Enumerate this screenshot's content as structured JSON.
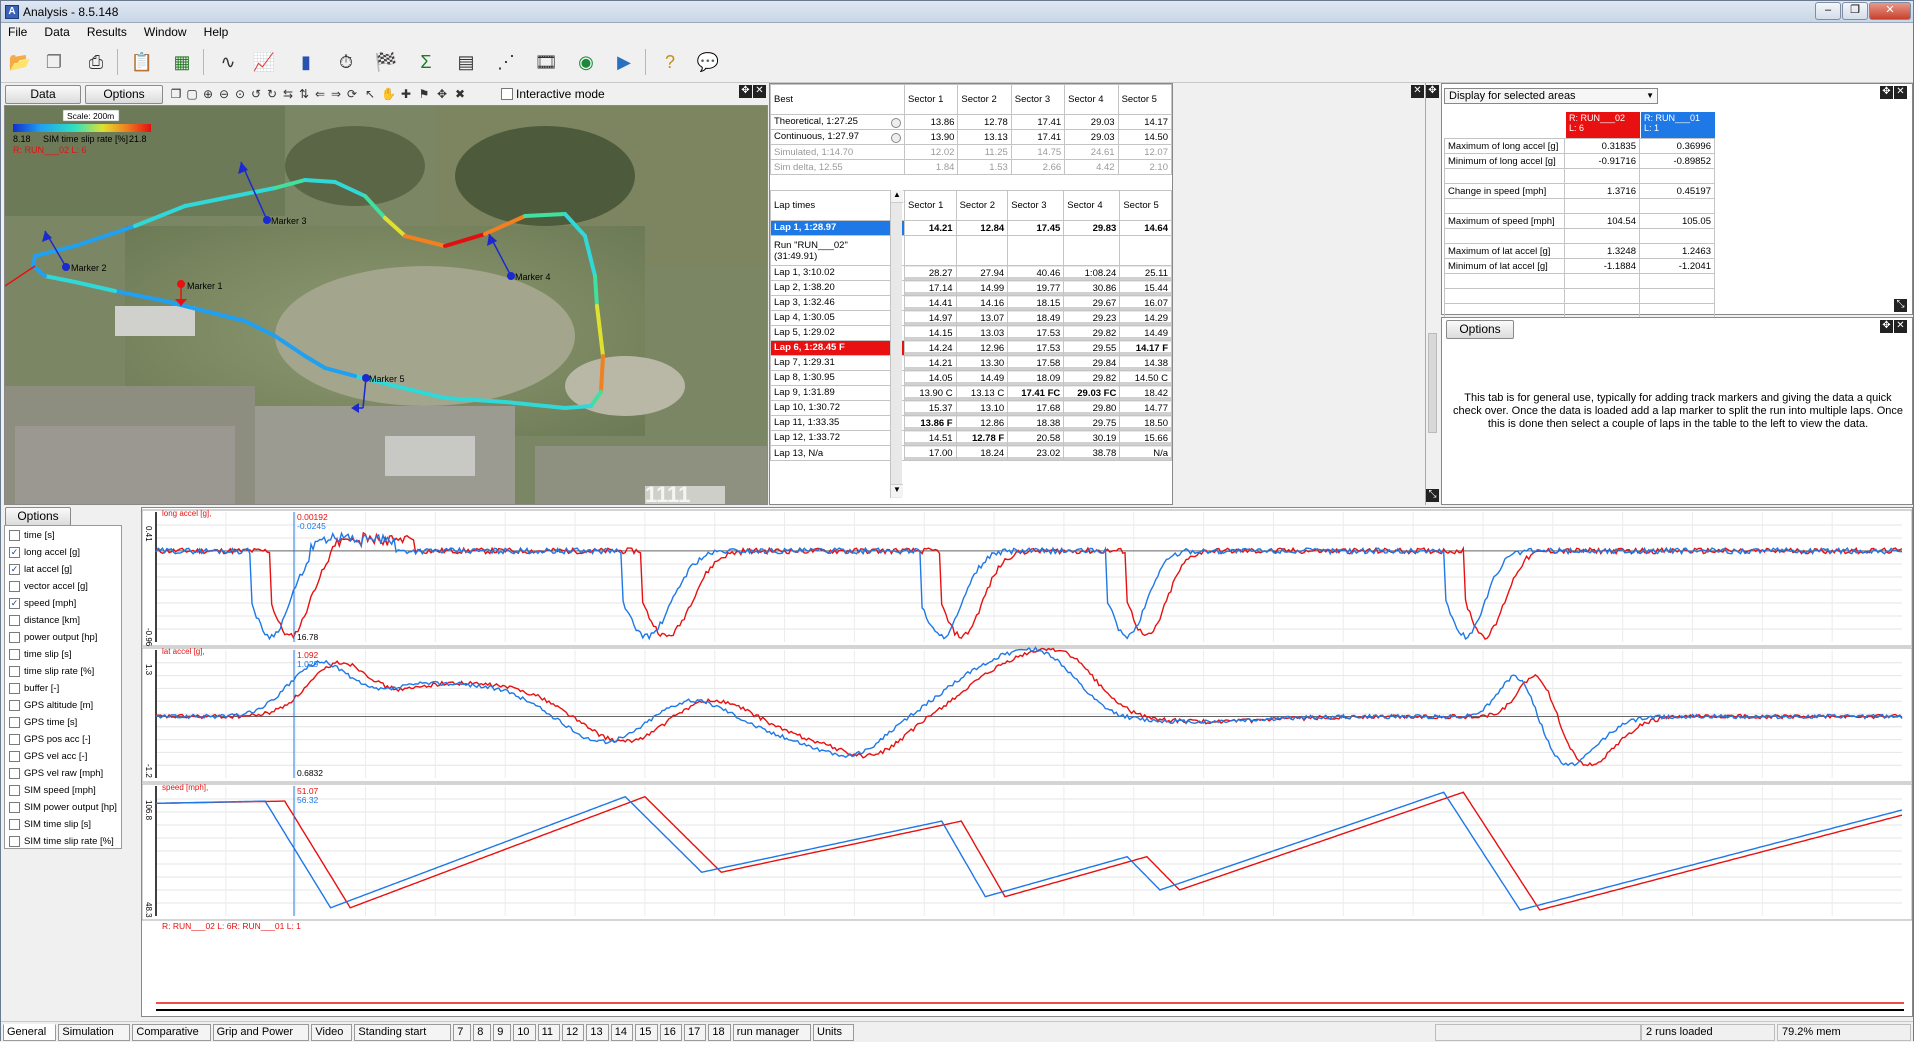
{
  "window": {
    "title": "Analysis - 8.5.148"
  },
  "menu": [
    "File",
    "Data",
    "Results",
    "Window",
    "Help"
  ],
  "map": {
    "data_tab": "Data",
    "options_tab": "Options",
    "interactive_mode": "Interactive mode",
    "scale": "Scale: 200m",
    "legend_min": "8.18",
    "legend_label": "SIM time slip rate [%]",
    "legend_max": "21.8",
    "run_label": "R: RUN___02  L: 6",
    "markers": [
      "Marker 1",
      "Marker 2",
      "Marker 3",
      "Marker 4",
      "Marker 5"
    ],
    "watermark": "1111"
  },
  "best_table": {
    "header": [
      "Best",
      "Sector 1",
      "Sector 2",
      "Sector 3",
      "Sector 4",
      "Sector 5"
    ],
    "rows": [
      {
        "label": "Theoretical, 1:27.25",
        "v": [
          "13.86",
          "12.78",
          "17.41",
          "29.03",
          "14.17"
        ]
      },
      {
        "label": "Continuous, 1:27.97",
        "v": [
          "13.90",
          "13.13",
          "17.41",
          "29.03",
          "14.50"
        ]
      },
      {
        "label": "Simulated, 1:14.70",
        "v": [
          "12.02",
          "11.25",
          "14.75",
          "24.61",
          "12.07"
        ]
      },
      {
        "label": "Sim delta, 12.55",
        "v": [
          "1.84",
          "1.53",
          "2.66",
          "4.42",
          "2.10"
        ]
      }
    ]
  },
  "lap_table": {
    "header": [
      "Lap times",
      "Sector 1",
      "Sector 2",
      "Sector 3",
      "Sector 4",
      "Sector 5"
    ],
    "selected": {
      "label": "Lap 1, 1:28.97",
      "v": [
        "14.21",
        "12.84",
        "17.45",
        "29.83",
        "14.64"
      ]
    },
    "run_title": "Run \"RUN___02\"",
    "run_time": "(31:49.91)",
    "rows": [
      {
        "label": "Lap 1, 3:10.02",
        "v": [
          "28.27",
          "27.94",
          "40.46",
          "1:08.24",
          "25.11"
        ]
      },
      {
        "label": "Lap 2, 1:38.20",
        "v": [
          "17.14",
          "14.99",
          "19.77",
          "30.86",
          "15.44"
        ]
      },
      {
        "label": "Lap 3, 1:32.46",
        "v": [
          "14.41",
          "14.16",
          "18.15",
          "29.67",
          "16.07"
        ]
      },
      {
        "label": "Lap 4, 1:30.05",
        "v": [
          "14.97",
          "13.07",
          "18.49",
          "29.23",
          "14.29"
        ]
      },
      {
        "label": "Lap 5, 1:29.02",
        "v": [
          "14.15",
          "13.03",
          "17.53",
          "29.82",
          "14.49"
        ]
      },
      {
        "label": "Lap 6, 1:28.45 F",
        "v": [
          "14.24",
          "12.96",
          "17.53",
          "29.55",
          "14.17 F"
        ]
      },
      {
        "label": "Lap 7, 1:29.31",
        "v": [
          "14.21",
          "13.30",
          "17.58",
          "29.84",
          "14.38"
        ]
      },
      {
        "label": "Lap 8, 1:30.95",
        "v": [
          "14.05",
          "14.49",
          "18.09",
          "29.82",
          "14.50 C"
        ]
      },
      {
        "label": "Lap 9, 1:31.89",
        "v": [
          "13.90 C",
          "13.13 C",
          "17.41 FC",
          "29.03 FC",
          "18.42"
        ]
      },
      {
        "label": "Lap 10, 1:30.72",
        "v": [
          "15.37",
          "13.10",
          "17.68",
          "29.80",
          "14.77"
        ]
      },
      {
        "label": "Lap 11, 1:33.35",
        "v": [
          "13.86 F",
          "12.86",
          "18.38",
          "29.75",
          "18.50"
        ]
      },
      {
        "label": "Lap 12, 1:33.72",
        "v": [
          "14.51",
          "12.78 F",
          "20.58",
          "30.19",
          "15.66"
        ]
      },
      {
        "label": "Lap 13, N/a",
        "v": [
          "17.00",
          "18.24",
          "23.02",
          "38.78",
          "N/a"
        ]
      }
    ]
  },
  "stats": {
    "dropdown": "Display for selected areas",
    "col_red": [
      "R: RUN___02",
      "L: 6"
    ],
    "col_blue": [
      "R: RUN___01",
      "L: 1"
    ],
    "rows": [
      {
        "label": "Maximum of long accel [g]",
        "a": "0.31835",
        "b": "0.36996"
      },
      {
        "label": "Minimum of long accel [g]",
        "a": "-0.91716",
        "b": "-0.89852"
      },
      {
        "label": "",
        "a": "",
        "b": ""
      },
      {
        "label": "Change in speed [mph]",
        "a": "1.3716",
        "b": "0.45197"
      },
      {
        "label": "",
        "a": "",
        "b": ""
      },
      {
        "label": "Maximum of speed [mph]",
        "a": "104.54",
        "b": "105.05"
      },
      {
        "label": "",
        "a": "",
        "b": ""
      },
      {
        "label": "Maximum of lat accel [g]",
        "a": "1.3248",
        "b": "1.2463"
      },
      {
        "label": "Minimum of lat accel [g]",
        "a": "-1.1884",
        "b": "-1.2041"
      },
      {
        "label": "",
        "a": "",
        "b": ""
      },
      {
        "label": "",
        "a": "",
        "b": ""
      },
      {
        "label": "",
        "a": "",
        "b": ""
      },
      {
        "label": "",
        "a": "",
        "b": ""
      },
      {
        "label": "",
        "a": "",
        "b": ""
      }
    ],
    "options": "Options",
    "info": "This tab is for general use, typically for adding track markers and giving the data a quick check over. Once the data is loaded add a lap marker to split the run into multiple laps. Once this is done then select a couple of laps in the table to the left to view the data."
  },
  "channels": {
    "options": "Options",
    "items": [
      {
        "name": "time [s]",
        "checked": false
      },
      {
        "name": "long accel [g]",
        "checked": true
      },
      {
        "name": "lat accel [g]",
        "checked": true
      },
      {
        "name": "vector accel [g]",
        "checked": false
      },
      {
        "name": "speed [mph]",
        "checked": true
      },
      {
        "name": "distance [km]",
        "checked": false
      },
      {
        "name": "power output [hp]",
        "checked": false
      },
      {
        "name": "time slip [s]",
        "checked": false
      },
      {
        "name": "time slip rate [%]",
        "checked": false
      },
      {
        "name": "buffer [-]",
        "checked": false
      },
      {
        "name": "GPS altitude [m]",
        "checked": false
      },
      {
        "name": "GPS time [s]",
        "checked": false
      },
      {
        "name": "GPS pos acc [-]",
        "checked": false
      },
      {
        "name": "GPS vel acc [-]",
        "checked": false
      },
      {
        "name": "GPS vel raw [mph]",
        "checked": false
      },
      {
        "name": "SIM speed [mph]",
        "checked": false
      },
      {
        "name": "SIM power output [hp]",
        "checked": false
      },
      {
        "name": "SIM time slip [s]",
        "checked": false
      },
      {
        "name": "SIM time slip rate [%]",
        "checked": false
      }
    ]
  },
  "chart_data": [
    {
      "type": "line",
      "title": "long accel [g],",
      "ylim": [
        -0.96,
        0.41
      ],
      "tick_top": "0.41",
      "tick_bottom": "-0.96",
      "cursor_x": "16.78",
      "cursor_values": [
        "0.00192",
        "-0.0245"
      ],
      "series": [
        {
          "name": "R: RUN___02  L: 6",
          "color": "#e81010"
        },
        {
          "name": "R: RUN___01  L: 1",
          "color": "#1e78e6"
        }
      ]
    },
    {
      "type": "line",
      "title": "lat accel [g],",
      "ylim": [
        -1.2,
        1.3
      ],
      "tick_top": "1.3",
      "tick_bottom": "-1.2",
      "cursor_x": "0.6832",
      "cursor_values": [
        "1.092",
        "1.029"
      ],
      "series": [
        {
          "name": "R: RUN___02  L: 6",
          "color": "#e81010"
        },
        {
          "name": "R: RUN___01  L: 1",
          "color": "#1e78e6"
        }
      ]
    },
    {
      "type": "line",
      "title": "speed [mph],",
      "ylim": [
        48.3,
        106.8
      ],
      "tick_top": "106.8",
      "tick_bottom": "48.3",
      "cursor_values": [
        "51.07",
        "56.32"
      ],
      "legend_text": "R: RUN___02  L: 6R: RUN___01  L: 1",
      "series": [
        {
          "name": "R: RUN___02  L: 6",
          "color": "#e81010"
        },
        {
          "name": "R: RUN___01  L: 1",
          "color": "#1e78e6"
        }
      ]
    }
  ],
  "tabs": [
    "General",
    "Simulation",
    "Comparative",
    "Grip and Power",
    "Video",
    "Standing start",
    "7",
    "8",
    "9",
    "10",
    "11",
    "12",
    "13",
    "14",
    "15",
    "16",
    "17",
    "18",
    "run manager",
    "Units"
  ],
  "status": {
    "runs": "2 runs loaded",
    "mem": "79.2% mem"
  },
  "colors": {
    "red": "#e81010",
    "blue": "#1e78e6",
    "selected_row": "#1e78e6",
    "flagged_row": "#e81010"
  }
}
